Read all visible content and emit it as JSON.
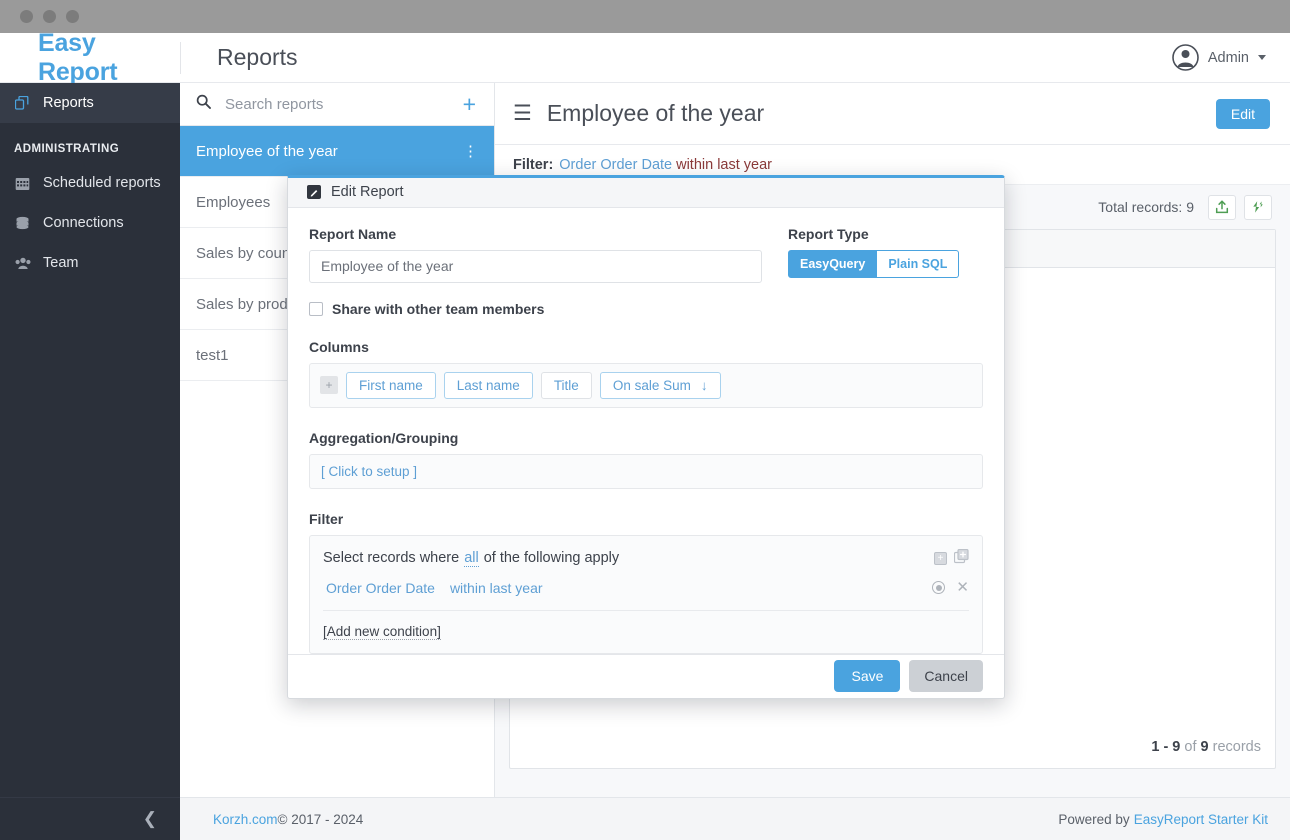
{
  "window": {
    "dots": 3
  },
  "header": {
    "brand": "Easy Report",
    "page_title": "Reports",
    "user_name": "Admin",
    "avatar_icon": "user-circle-icon",
    "caret_icon": "chevron-down-icon"
  },
  "sidebar": {
    "items": [
      {
        "label": "Reports",
        "icon": "layers-icon",
        "active": true
      }
    ],
    "section_label": "ADMINISTRATING",
    "admin_items": [
      {
        "label": "Scheduled reports",
        "icon": "calendar-icon"
      },
      {
        "label": "Connections",
        "icon": "database-icon"
      },
      {
        "label": "Team",
        "icon": "users-icon"
      }
    ],
    "collapse_icon": "chevron-left-icon"
  },
  "report_list": {
    "search_placeholder": "Search reports",
    "search_value": "",
    "search_icon": "search-icon",
    "add_icon": "plus-icon",
    "items": [
      {
        "label": "Employee of the year",
        "selected": true,
        "kebab_icon": "kebab-menu-icon"
      },
      {
        "label": "Employees",
        "selected": false
      },
      {
        "label": "Sales by country",
        "selected": false
      },
      {
        "label": "Sales by product",
        "selected": false
      },
      {
        "label": "test1",
        "selected": false
      }
    ],
    "footer_link": "Korzh.com",
    "footer_text": " © 2017 - 2024"
  },
  "main": {
    "menu_icon": "hamburger-icon",
    "report_title": "Employee of the year",
    "edit_label": "Edit",
    "filter_label": "Filter:",
    "filter_field": "Order Order Date",
    "filter_operator": "within last year",
    "total_records": "Total records: 9",
    "export_icon": "export-upload-icon",
    "refresh_icon": "refresh-sync-icon",
    "pager_range": "1 - 9",
    "pager_of": "of",
    "pager_total": "9",
    "pager_suffix": "records",
    "footer_text": "Powered by",
    "footer_link": "EasyReport Starter Kit"
  },
  "modal": {
    "title": "Edit Report",
    "title_icon": "edit-pencil-icon",
    "report_name_label": "Report Name",
    "report_name_value": "Employee of the year",
    "report_type_label": "Report Type",
    "report_type_options": [
      "EasyQuery",
      "Plain SQL"
    ],
    "report_type_selected": "EasyQuery",
    "share_label": "Share with other team members",
    "share_checked": false,
    "columns_label": "Columns",
    "columns_add_icon": "plus-square-icon",
    "columns": [
      {
        "label": "First name",
        "sort": "",
        "style": "link"
      },
      {
        "label": "Last name",
        "sort": "",
        "style": "link"
      },
      {
        "label": "Title",
        "sort": "",
        "style": "plain"
      },
      {
        "label": "On sale Sum",
        "sort": "↓",
        "style": "link"
      }
    ],
    "aggregation_label": "Aggregation/Grouping",
    "aggregation_value": "[ Click to setup ]",
    "filter_label": "Filter",
    "filter_prefix": "Select records where",
    "filter_all": "all",
    "filter_suffix": "of the following apply",
    "filter_add_icon": "add-condition-icon",
    "filter_add_group_icon": "add-group-icon",
    "condition_field": "Order Order Date",
    "condition_operator": "within last year",
    "condition_toggle_icon": "radio-target-icon",
    "condition_remove_icon": "close-x-icon",
    "add_condition_label": "[Add new condition]",
    "save_label": "Save",
    "cancel_label": "Cancel"
  },
  "colors": {
    "accent": "#4aa3df",
    "sidebar_bg": "#2b303a",
    "chrome_bg": "#9a9a9a",
    "filter_op": "#8b3a3a",
    "green_icon": "#4f9e54"
  }
}
